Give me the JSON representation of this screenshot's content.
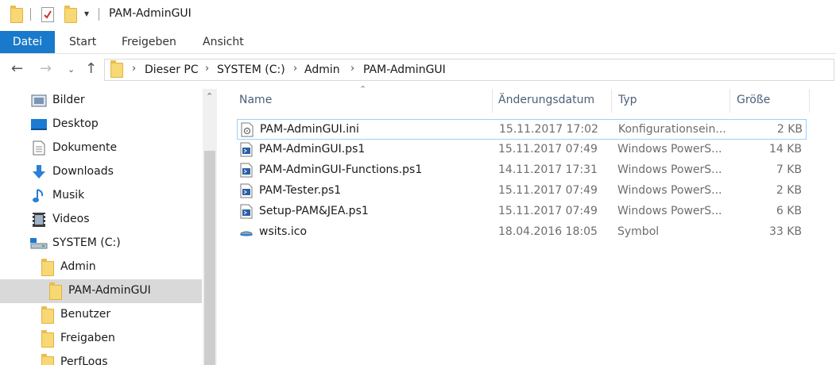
{
  "window": {
    "title": "PAM-AdminGUI"
  },
  "ribbon": {
    "tabs": [
      "Datei",
      "Start",
      "Freigeben",
      "Ansicht"
    ]
  },
  "address": {
    "crumbs": [
      "Dieser PC",
      "SYSTEM (C:)",
      "Admin",
      "PAM-AdminGUI"
    ]
  },
  "nav": {
    "items": [
      {
        "label": "Bilder",
        "icon": "pictures-icon"
      },
      {
        "label": "Desktop",
        "icon": "desktop-icon"
      },
      {
        "label": "Dokumente",
        "icon": "documents-icon"
      },
      {
        "label": "Downloads",
        "icon": "downloads-icon"
      },
      {
        "label": "Musik",
        "icon": "music-icon"
      },
      {
        "label": "Videos",
        "icon": "videos-icon"
      },
      {
        "label": "SYSTEM (C:)",
        "icon": "drive-icon"
      },
      {
        "label": "Admin",
        "icon": "folder-icon"
      },
      {
        "label": "PAM-AdminGUI",
        "icon": "folder-icon",
        "selected": true
      },
      {
        "label": "Benutzer",
        "icon": "folder-icon"
      },
      {
        "label": "Freigaben",
        "icon": "folder-icon"
      },
      {
        "label": "PerfLogs",
        "icon": "folder-icon"
      }
    ]
  },
  "list": {
    "columns": {
      "name": "Name",
      "date": "Änderungsdatum",
      "type": "Typ",
      "size": "Größe"
    },
    "files": [
      {
        "name": "PAM-AdminGUI.ini",
        "date": "15.11.2017 17:02",
        "type": "Konfigurationsein...",
        "size": "2 KB",
        "icon": "config-file-icon"
      },
      {
        "name": "PAM-AdminGUI.ps1",
        "date": "15.11.2017 07:49",
        "type": "Windows PowerS...",
        "size": "14 KB",
        "icon": "powershell-file-icon"
      },
      {
        "name": "PAM-AdminGUI-Functions.ps1",
        "date": "14.11.2017 17:31",
        "type": "Windows PowerS...",
        "size": "7 KB",
        "icon": "powershell-file-icon"
      },
      {
        "name": "PAM-Tester.ps1",
        "date": "15.11.2017 07:49",
        "type": "Windows PowerS...",
        "size": "2 KB",
        "icon": "powershell-file-icon"
      },
      {
        "name": "Setup-PAM&JEA.ps1",
        "date": "15.11.2017 07:49",
        "type": "Windows PowerS...",
        "size": "6 KB",
        "icon": "powershell-file-icon"
      },
      {
        "name": "wsits.ico",
        "date": "18.04.2016 18:05",
        "type": "Symbol",
        "size": "33 KB",
        "icon": "image-file-icon"
      }
    ]
  },
  "colors": {
    "accent": "#1979ca",
    "selection": "#d9d9d9",
    "hover_border": "#99d1ff"
  }
}
